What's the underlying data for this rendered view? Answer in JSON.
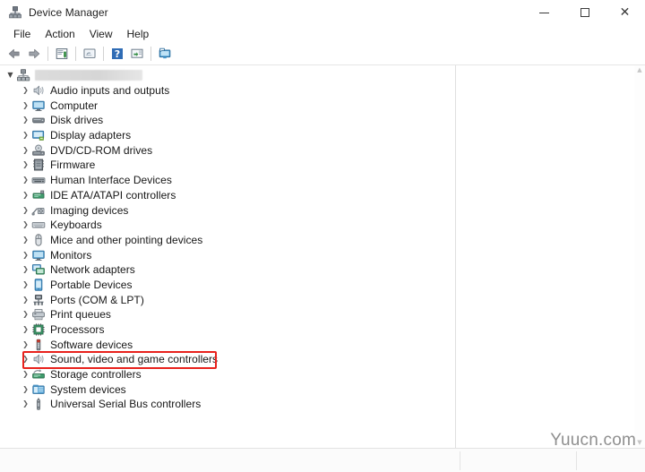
{
  "window": {
    "title": "Device Manager",
    "title_icon": "device-manager-icon",
    "controls": {
      "minimize": "minimize-button",
      "maximize": "maximize-button",
      "close": "close-button"
    }
  },
  "menubar": {
    "items": [
      {
        "label": "File",
        "name": "menu-file"
      },
      {
        "label": "Action",
        "name": "menu-action"
      },
      {
        "label": "View",
        "name": "menu-view"
      },
      {
        "label": "Help",
        "name": "menu-help"
      }
    ]
  },
  "toolbar": {
    "buttons": [
      {
        "name": "back-button",
        "icon": "back-arrow-icon",
        "tooltip": "Back"
      },
      {
        "name": "forward-button",
        "icon": "forward-arrow-icon",
        "tooltip": "Forward"
      },
      {
        "name": "separator-1",
        "icon": "separator",
        "tooltip": ""
      },
      {
        "name": "show-hidden-devices-button",
        "icon": "properties-icon",
        "tooltip": "Properties"
      },
      {
        "name": "separator-2",
        "icon": "separator",
        "tooltip": ""
      },
      {
        "name": "update-driver-button",
        "icon": "update-driver-icon",
        "tooltip": "Update driver"
      },
      {
        "name": "separator-3",
        "icon": "separator",
        "tooltip": ""
      },
      {
        "name": "help-button",
        "icon": "help-icon",
        "tooltip": "Help"
      },
      {
        "name": "scan-hardware-button",
        "icon": "scan-hardware-icon",
        "tooltip": "Scan for hardware changes"
      },
      {
        "name": "separator-4",
        "icon": "separator",
        "tooltip": ""
      },
      {
        "name": "display-devices-button",
        "icon": "monitor-icon",
        "tooltip": "Display devices"
      }
    ]
  },
  "tree": {
    "root": {
      "name": "tree-root-computer",
      "label": "",
      "redacted": true,
      "icon": "computer-root-icon",
      "expanded": true,
      "chevron": "chevron-down-icon"
    },
    "items": [
      {
        "label": "Audio inputs and outputs",
        "icon": "speaker-icon",
        "name": "tree-item-audio-inputs-and-outputs"
      },
      {
        "label": "Computer",
        "icon": "monitor-icon",
        "name": "tree-item-computer"
      },
      {
        "label": "Disk drives",
        "icon": "disk-drive-icon",
        "name": "tree-item-disk-drives"
      },
      {
        "label": "Display adapters",
        "icon": "display-adapter-icon",
        "name": "tree-item-display-adapters"
      },
      {
        "label": "DVD/CD-ROM drives",
        "icon": "optical-drive-icon",
        "name": "tree-item-dvd-cd-rom-drives"
      },
      {
        "label": "Firmware",
        "icon": "firmware-chip-icon",
        "name": "tree-item-firmware"
      },
      {
        "label": "Human Interface Devices",
        "icon": "hid-icon",
        "name": "tree-item-human-interface-devices"
      },
      {
        "label": "IDE ATA/ATAPI controllers",
        "icon": "ide-controller-icon",
        "name": "tree-item-ide-ata-atapi-controllers"
      },
      {
        "label": "Imaging devices",
        "icon": "imaging-device-icon",
        "name": "tree-item-imaging-devices"
      },
      {
        "label": "Keyboards",
        "icon": "keyboard-icon",
        "name": "tree-item-keyboards"
      },
      {
        "label": "Mice and other pointing devices",
        "icon": "mouse-icon",
        "name": "tree-item-mice-and-other-pointing-devices"
      },
      {
        "label": "Monitors",
        "icon": "monitor-icon",
        "name": "tree-item-monitors"
      },
      {
        "label": "Network adapters",
        "icon": "network-adapter-icon",
        "name": "tree-item-network-adapters"
      },
      {
        "label": "Portable Devices",
        "icon": "portable-device-icon",
        "name": "tree-item-portable-devices"
      },
      {
        "label": "Ports (COM & LPT)",
        "icon": "port-icon",
        "name": "tree-item-ports-com-and-lpt"
      },
      {
        "label": "Print queues",
        "icon": "printer-icon",
        "name": "tree-item-print-queues"
      },
      {
        "label": "Processors",
        "icon": "processor-icon",
        "name": "tree-item-processors"
      },
      {
        "label": "Software devices",
        "icon": "software-device-icon",
        "name": "tree-item-software-devices"
      },
      {
        "label": "Sound, video and game controllers",
        "icon": "speaker-icon",
        "name": "tree-item-sound-video-and-game-controllers",
        "highlighted": true
      },
      {
        "label": "Storage controllers",
        "icon": "storage-controller-icon",
        "name": "tree-item-storage-controllers"
      },
      {
        "label": "System devices",
        "icon": "system-device-icon",
        "name": "tree-item-system-devices"
      },
      {
        "label": "Universal Serial Bus controllers",
        "icon": "usb-icon",
        "name": "tree-item-universal-serial-bus-controllers"
      }
    ],
    "chevron_collapsed": "chevron-right-icon"
  },
  "highlight": {
    "target_label": "Sound, video and game controllers",
    "color": "#e8211c"
  },
  "watermark": {
    "text": "Yuucn.com"
  },
  "colors": {
    "accent": "#e8211c",
    "window_bg": "#ffffff",
    "text": "#161616",
    "divider": "#e0e0e0"
  }
}
